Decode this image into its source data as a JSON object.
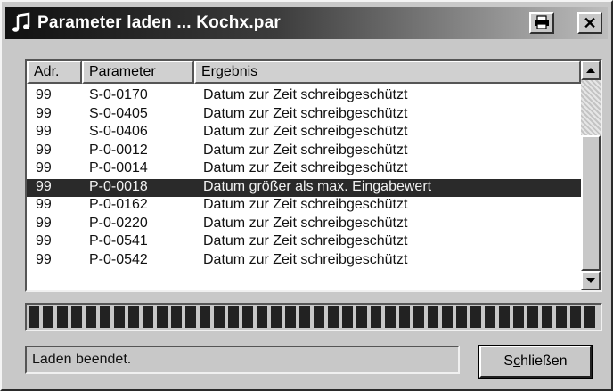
{
  "window": {
    "title": "Parameter laden ... Kochx.par",
    "icons": {
      "app": "music-note-icon",
      "print": "printer-icon",
      "close": "close-icon"
    },
    "close_glyph": "✕"
  },
  "list": {
    "columns": [
      "Adr.",
      "Parameter",
      "Ergebnis"
    ],
    "rows": [
      {
        "adr": "99",
        "parameter": "S-0-0170",
        "ergebnis": "Datum zur Zeit schreibgeschützt"
      },
      {
        "adr": "99",
        "parameter": "S-0-0405",
        "ergebnis": "Datum zur Zeit schreibgeschützt"
      },
      {
        "adr": "99",
        "parameter": "S-0-0406",
        "ergebnis": "Datum zur Zeit schreibgeschützt"
      },
      {
        "adr": "99",
        "parameter": "P-0-0012",
        "ergebnis": "Datum zur Zeit schreibgeschützt"
      },
      {
        "adr": "99",
        "parameter": "P-0-0014",
        "ergebnis": "Datum zur Zeit schreibgeschützt"
      },
      {
        "adr": "99",
        "parameter": "P-0-0018",
        "ergebnis": "Datum größer als max. Eingabewert"
      },
      {
        "adr": "99",
        "parameter": "P-0-0162",
        "ergebnis": "Datum zur Zeit schreibgeschützt"
      },
      {
        "adr": "99",
        "parameter": "P-0-0220",
        "ergebnis": "Datum zur Zeit schreibgeschützt"
      },
      {
        "adr": "99",
        "parameter": "P-0-0541",
        "ergebnis": "Datum zur Zeit schreibgeschützt"
      },
      {
        "adr": "99",
        "parameter": "P-0-0542",
        "ergebnis": "Datum zur Zeit schreibgeschützt"
      }
    ],
    "selected_index": 5
  },
  "progress": {
    "fraction": 1.0
  },
  "status": {
    "text": "Laden beendet."
  },
  "buttons": {
    "close_label": "Schließen"
  },
  "colors": {
    "selection": "#2a2a2a",
    "titlebar_start": "#111111",
    "face": "#c8c8c8"
  }
}
